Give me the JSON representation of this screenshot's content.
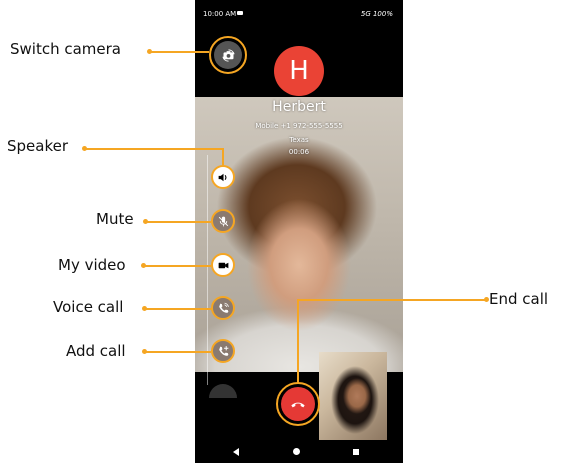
{
  "status_bar": {
    "time": "10:00 AM",
    "right": "5G 100%"
  },
  "call": {
    "avatar_letter": "H",
    "name": "Herbert",
    "number": "Mobile +1 972-555-5555",
    "location": "Texas",
    "duration": "00:06"
  },
  "labels": {
    "switch_camera": "Switch camera",
    "speaker": "Speaker",
    "mute": "Mute",
    "my_video": "My video",
    "voice_call": "Voice call",
    "add_call": "Add call",
    "end_call": "End call"
  },
  "colors": {
    "callout": "#f5a623",
    "end_call": "#e53935",
    "avatar": "#ea4335"
  },
  "icons": [
    "switch-camera-icon",
    "speaker-icon",
    "mic-off-icon",
    "video-icon",
    "voice-call-icon",
    "add-call-icon",
    "end-call-icon",
    "back-icon",
    "home-icon",
    "recents-icon"
  ]
}
